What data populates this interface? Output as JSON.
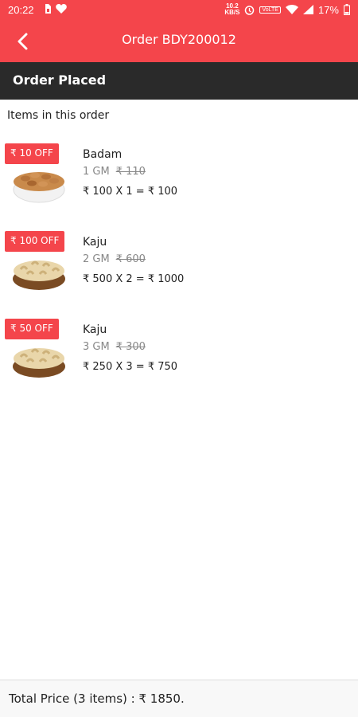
{
  "status_bar": {
    "time": "20:22",
    "net_speed_top": "10.2",
    "net_speed_bottom": "KB/S",
    "volte": "VoLTE",
    "battery": "17%"
  },
  "app_bar": {
    "title": "Order BDY200012",
    "back_icon": "back-arrow-icon"
  },
  "order_status": "Order Placed",
  "section_label": "Items in this order",
  "items": [
    {
      "badge": "₹ 10 OFF",
      "name": "Badam",
      "weight": "1 GM",
      "mrp": "₹ 110",
      "calc": "₹ 100 X 1 = ₹ 100",
      "image": "almonds-bowl"
    },
    {
      "badge": "₹ 100 OFF",
      "name": "Kaju",
      "weight": "2 GM",
      "mrp": "₹ 600",
      "calc": "₹ 500 X 2 = ₹ 1000",
      "image": "cashew-basket"
    },
    {
      "badge": "₹ 50 OFF",
      "name": "Kaju",
      "weight": "3 GM",
      "mrp": "₹ 300",
      "calc": "₹ 250 X 3 = ₹ 750",
      "image": "cashew-basket"
    }
  ],
  "total": "Total Price (3 items) :  ₹ 1850.",
  "colors": {
    "accent": "#f4454b",
    "dark_strip": "#2a2a2a"
  }
}
